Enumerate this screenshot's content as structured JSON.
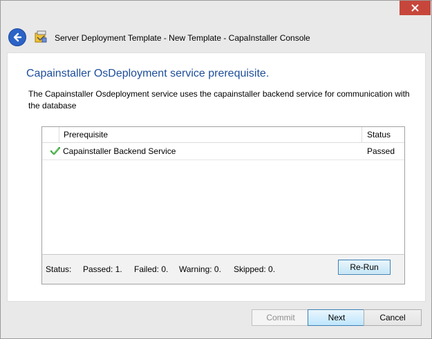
{
  "window": {
    "title": "Server Deployment Template - New Template - CapaInstaller Console"
  },
  "page": {
    "heading": "Capainstaller OsDeployment service prerequisite.",
    "description": "The Capainstaller Osdeployment service uses the capainstaller backend service for communication with the database"
  },
  "grid": {
    "columns": [
      "Prerequisite",
      "Status"
    ],
    "rows": [
      {
        "icon": "checkmark-icon",
        "name": "Capainstaller Backend Service",
        "status": "Passed"
      }
    ]
  },
  "status_bar": {
    "label": "Status:",
    "passed": "Passed: 1.",
    "failed": "Failed: 0.",
    "warning": "Warning: 0.",
    "skipped": "Skipped: 0.",
    "rerun_label": "Re-Run"
  },
  "buttons": {
    "commit": "Commit",
    "next": "Next",
    "cancel": "Cancel"
  },
  "colors": {
    "heading": "#1e4e9a",
    "close": "#c7463b",
    "back": "#2b63c7",
    "passed_check": "#3aa83a"
  }
}
